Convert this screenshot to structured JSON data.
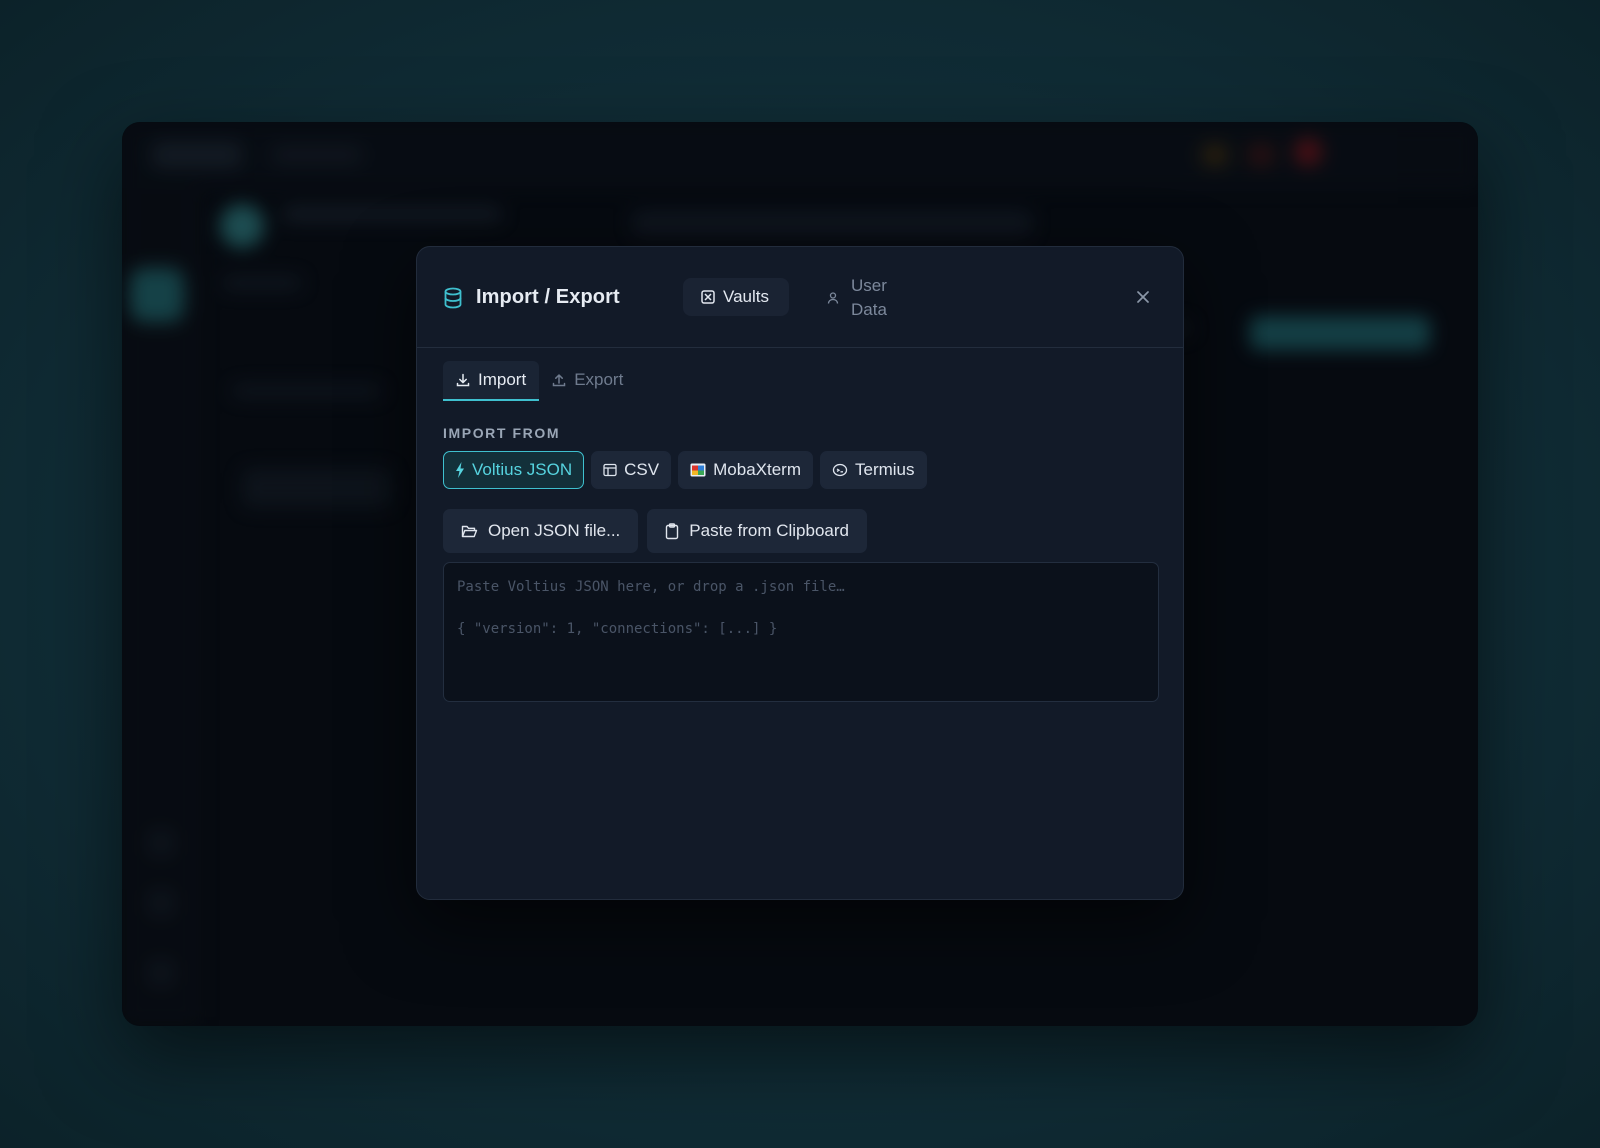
{
  "modal": {
    "title": "Import / Export",
    "scope_tabs": [
      {
        "label": "Vaults",
        "icon": "vault-icon",
        "active": true
      },
      {
        "label": "User Data",
        "icon": "user-icon",
        "active": false
      }
    ],
    "mode_tabs": [
      {
        "label": "Import",
        "icon": "download-icon",
        "active": true
      },
      {
        "label": "Export",
        "icon": "upload-icon",
        "active": false
      }
    ],
    "section_label": "IMPORT FROM",
    "sources": [
      {
        "label": "Voltius JSON",
        "icon": "bolt-icon",
        "active": true
      },
      {
        "label": "CSV",
        "icon": "table-icon",
        "active": false
      },
      {
        "label": "MobaXterm",
        "icon": "mobaxterm-logo-icon",
        "active": false
      },
      {
        "label": "Termius",
        "icon": "termius-logo-icon",
        "active": false
      }
    ],
    "actions": [
      {
        "label": "Open JSON file...",
        "icon": "folder-open-icon"
      },
      {
        "label": "Paste from Clipboard",
        "icon": "clipboard-icon"
      }
    ],
    "textarea": {
      "value": "",
      "placeholder": "Paste Voltius JSON here, or drop a .json file…\n\n{ \"version\": 1, \"connections\": [...] }"
    }
  },
  "colors": {
    "accent": "#3fc0cf",
    "modal_bg": "#121a28",
    "chip_bg": "#1d2738"
  }
}
